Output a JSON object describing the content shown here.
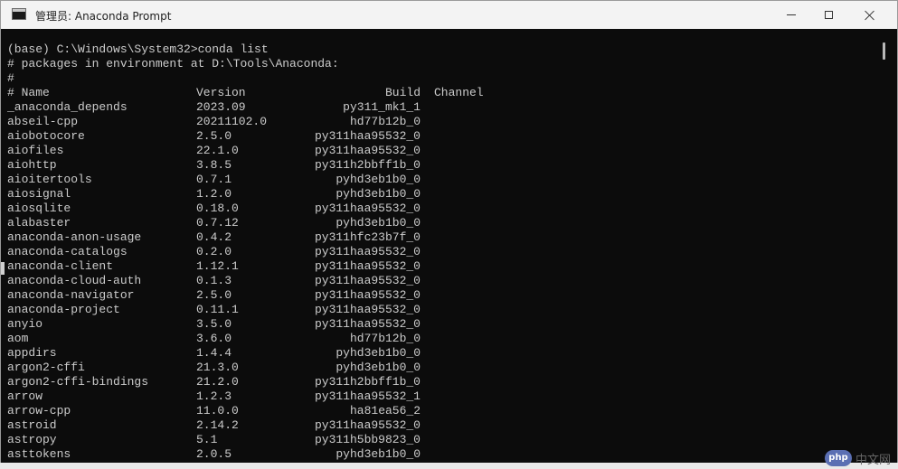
{
  "window": {
    "title": "管理员: Anaconda Prompt"
  },
  "console": {
    "command_line": "(base) C:\\Windows\\System32>conda list",
    "env_line": "# packages in environment at D:\\Tools\\Anaconda:",
    "hash_line": "#",
    "header": {
      "name": "# Name",
      "version": "Version",
      "build": "Build",
      "channel": "Channel"
    },
    "packages": [
      {
        "name": "_anaconda_depends",
        "version": "2023.09",
        "build": "py311_mk1_1"
      },
      {
        "name": "abseil-cpp",
        "version": "20211102.0",
        "build": "hd77b12b_0"
      },
      {
        "name": "aiobotocore",
        "version": "2.5.0",
        "build": "py311haa95532_0"
      },
      {
        "name": "aiofiles",
        "version": "22.1.0",
        "build": "py311haa95532_0"
      },
      {
        "name": "aiohttp",
        "version": "3.8.5",
        "build": "py311h2bbff1b_0"
      },
      {
        "name": "aioitertools",
        "version": "0.7.1",
        "build": "pyhd3eb1b0_0"
      },
      {
        "name": "aiosignal",
        "version": "1.2.0",
        "build": "pyhd3eb1b0_0"
      },
      {
        "name": "aiosqlite",
        "version": "0.18.0",
        "build": "py311haa95532_0"
      },
      {
        "name": "alabaster",
        "version": "0.7.12",
        "build": "pyhd3eb1b0_0"
      },
      {
        "name": "anaconda-anon-usage",
        "version": "0.4.2",
        "build": "py311hfc23b7f_0"
      },
      {
        "name": "anaconda-catalogs",
        "version": "0.2.0",
        "build": "py311haa95532_0"
      },
      {
        "name": "anaconda-client",
        "version": "1.12.1",
        "build": "py311haa95532_0"
      },
      {
        "name": "anaconda-cloud-auth",
        "version": "0.1.3",
        "build": "py311haa95532_0"
      },
      {
        "name": "anaconda-navigator",
        "version": "2.5.0",
        "build": "py311haa95532_0"
      },
      {
        "name": "anaconda-project",
        "version": "0.11.1",
        "build": "py311haa95532_0"
      },
      {
        "name": "anyio",
        "version": "3.5.0",
        "build": "py311haa95532_0"
      },
      {
        "name": "aom",
        "version": "3.6.0",
        "build": "hd77b12b_0"
      },
      {
        "name": "appdirs",
        "version": "1.4.4",
        "build": "pyhd3eb1b0_0"
      },
      {
        "name": "argon2-cffi",
        "version": "21.3.0",
        "build": "pyhd3eb1b0_0"
      },
      {
        "name": "argon2-cffi-bindings",
        "version": "21.2.0",
        "build": "py311h2bbff1b_0"
      },
      {
        "name": "arrow",
        "version": "1.2.3",
        "build": "py311haa95532_1"
      },
      {
        "name": "arrow-cpp",
        "version": "11.0.0",
        "build": "ha81ea56_2"
      },
      {
        "name": "astroid",
        "version": "2.14.2",
        "build": "py311haa95532_0"
      },
      {
        "name": "astropy",
        "version": "5.1",
        "build": "py311h5bb9823_0"
      },
      {
        "name": "asttokens",
        "version": "2.0.5",
        "build": "pyhd3eb1b0_0"
      }
    ]
  },
  "watermark": {
    "logo": "php",
    "text": "中文网"
  }
}
